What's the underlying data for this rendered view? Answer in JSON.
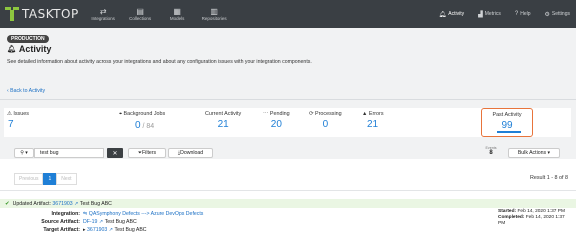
{
  "app": {
    "logo_text": "TASKTOP"
  },
  "nav": [
    {
      "label": "Integrations",
      "icon": "arrows-icon"
    },
    {
      "label": "Collections",
      "icon": "collection-icon"
    },
    {
      "label": "Models",
      "icon": "model-icon"
    },
    {
      "label": "Repositories",
      "icon": "repository-icon"
    }
  ],
  "topright": {
    "activity": "Activity",
    "metrics": "Metrics",
    "help": "Help",
    "settings": "Settings"
  },
  "page": {
    "environment": "PRODUCTION",
    "title": "Activity",
    "description": "See detailed information about activity across your integrations and about any configuration issues with your integration components.",
    "back_link": "Back to Activity"
  },
  "stats": {
    "issues": {
      "label": "Issues",
      "value": "7"
    },
    "background_jobs": {
      "label": "Background Jobs",
      "value": "0",
      "total": " / 84"
    },
    "current_activity": {
      "label": "Current Activity",
      "value": "21"
    },
    "pending": {
      "label": "Pending",
      "value": "20"
    },
    "processing": {
      "label": "Processing",
      "value": "0"
    },
    "errors": {
      "label": "Errors",
      "value": "21"
    },
    "past_activity": {
      "label": "Past Activity",
      "value": "99"
    }
  },
  "toolbar": {
    "search_value": "test bug",
    "filters_label": "Filters",
    "download_label": "Download",
    "events_label": "Events",
    "events_value": "8",
    "bulk_actions_label": "Bulk Actions"
  },
  "pagination": {
    "previous": "Previous",
    "current": "1",
    "next": "Next",
    "result_text": "Result 1 - 8 of 8"
  },
  "entry": {
    "header_prefix": "Updated Artifact:",
    "header_id": "3671903",
    "header_title": "Test Bug ABC",
    "integration_label": "Integration:",
    "integration_value": "QASymphony Defects ---> Azure DevOps Defects",
    "source_label": "Source Artifact:",
    "source_id": "DF-19",
    "source_title": "Test Bug ABC",
    "target_label": "Target Artifact:",
    "target_id": "3671903",
    "target_title": "Test Bug ABC",
    "started_label": "Started:",
    "started_value": "Feb 14, 2020 1:37 PM",
    "completed_label": "Completed:",
    "completed_value": "Feb 14, 2020 1:37 PM"
  },
  "colors": {
    "topbar": "#3a3f44",
    "accent": "#1f7fd6",
    "highlight": "#e8743b",
    "success_bg": "#eaf6e3"
  }
}
